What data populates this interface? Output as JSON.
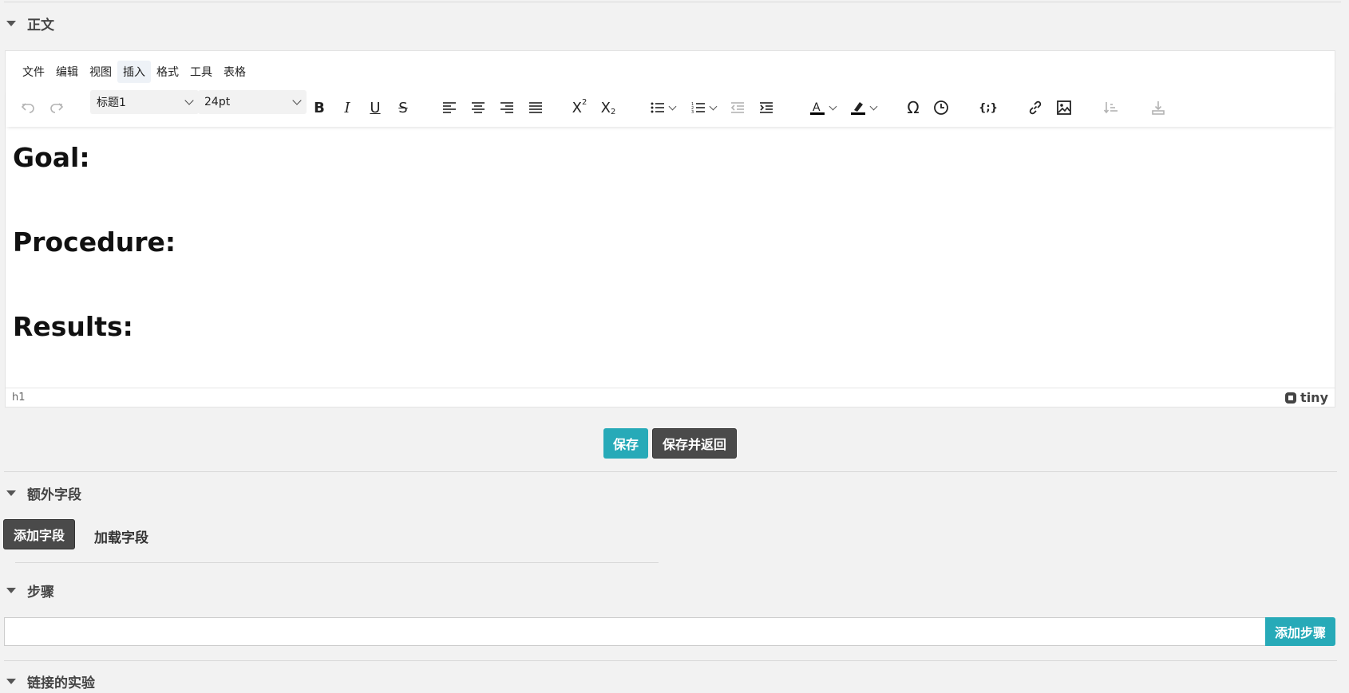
{
  "sections": {
    "body": "正文",
    "extra_fields": "额外字段",
    "steps": "步骤",
    "linked_experiments": "链接的实验"
  },
  "menubar": [
    "文件",
    "编辑",
    "视图",
    "插入",
    "格式",
    "工具",
    "表格"
  ],
  "toolbar": {
    "block_format": "标题1",
    "font_size": "24pt"
  },
  "content": {
    "headings": [
      "Goal:",
      "Procedure:",
      "Results:"
    ]
  },
  "statusbar": {
    "path": "h1",
    "brand": "tiny"
  },
  "buttons": {
    "save": "保存",
    "save_and_return": "保存并返回",
    "add_field": "添加字段",
    "load_field": "加载字段",
    "add_step": "添加步骤"
  },
  "step_input": {
    "value": "",
    "placeholder": ""
  },
  "colors": {
    "accent": "#27aab8",
    "dark_button": "#4a4a4a",
    "background": "#f2f2f2"
  }
}
